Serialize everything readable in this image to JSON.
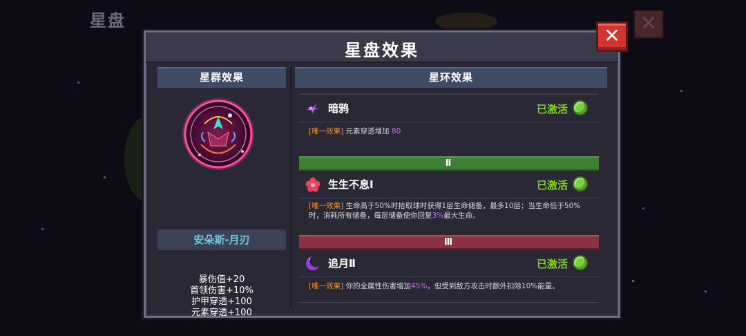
{
  "background": {
    "title": "星盘",
    "close_label": "✕"
  },
  "modal": {
    "title": "星盘效果",
    "close_label": "✕"
  },
  "left_panel": {
    "header": "星群效果",
    "constellation_name": "安朵斯-月刃",
    "stats": [
      "暴伤值+20",
      "首领伤害+10%",
      "护甲穿透+100",
      "元素穿透+100"
    ]
  },
  "right_panel": {
    "header": "星环效果",
    "effects": [
      {
        "icon": "raven-icon",
        "name": "暗鸦",
        "status": "已激活",
        "tag": "[唯一效果]",
        "desc_parts": [
          "元素穿透增加",
          "80",
          ""
        ]
      },
      {
        "icon": "flower-icon",
        "name": "生生不息Ⅰ",
        "status": "已激活",
        "tag": "[唯一效果]",
        "desc_parts": [
          "生命高于50%时拾取球时获得1层生命储备，最多10层；当生命低于50%时，消耗所有储备，每层储备使你回复",
          "3%",
          "最大生命。"
        ]
      },
      {
        "icon": "crescent-moon-icon",
        "name": "追月Ⅱ",
        "status": "已激活",
        "tag": "[唯一效果]",
        "desc_parts": [
          "你的全属性伤害增加",
          "45%",
          "，但受到敌方攻击时额外扣除10%能量。"
        ]
      }
    ],
    "tiers": [
      {
        "label": "Ⅱ",
        "color": "#3e7f35"
      },
      {
        "label": "Ⅲ",
        "color": "#893343"
      }
    ]
  },
  "colors": {
    "active_green": "#7ed321",
    "tag_orange": "#e8953a",
    "number_purple": "#c56cf0",
    "name_cyan": "#6fc9e2"
  }
}
